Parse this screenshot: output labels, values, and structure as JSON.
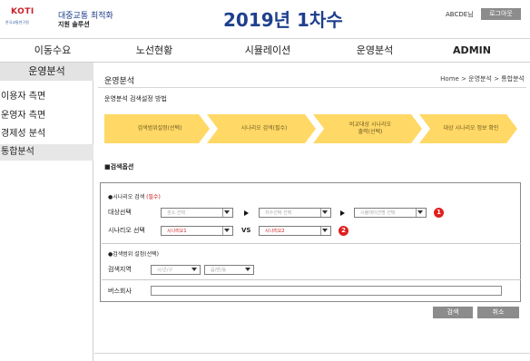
{
  "header": {
    "logo_text": "KOTI",
    "logo_sub": "한국교통연구원",
    "logo_title": "대중교통 최적화",
    "logo_subtitle": "지원 솔루션",
    "page_title": "2019년 1차수",
    "user_name": "ABCDE님",
    "logout_label": "로그아웃"
  },
  "topnav": {
    "items": [
      "이동수요",
      "노선현황",
      "시뮬레이션",
      "운영분석",
      "ADMIN"
    ]
  },
  "sidebar": {
    "title": "운영분석",
    "items": [
      "이용자 측면",
      "운영자 측면",
      "경제성 분석",
      "통합분석"
    ]
  },
  "main": {
    "title": "운영분석",
    "breadcrumb": "Home > 운영분석 > 통합분석",
    "subtitle": "운영분석 검색설정 방법",
    "steps": [
      "검색범위설정(선택)",
      "시나리오 검색(필수)",
      "비교대상 시나리오\n출력(선택)",
      "대상 시나리오 정보 확인"
    ],
    "search_options_label": "■검색옵션",
    "scenario_section": {
      "label": "●시나리오 검색 ",
      "required": "(필수)"
    },
    "target_select_label": "대상선택",
    "target_selects": [
      "권소 선택",
      "차수선택 선택",
      "시뮬레이션명 선택"
    ],
    "scenario_select_label": "시나리오 선택",
    "scenario_a": "시나리오1",
    "vs_label": "VS",
    "scenario_b": "시나리오2",
    "badge_1": "1",
    "badge_2": "2",
    "range_section_label": "●검색범위 설정(선택)",
    "region_label": "검색지역",
    "region_selects": [
      "시/군/구",
      "읍/면/동"
    ],
    "bus_company_label": "버스회사",
    "bus_company_value": "",
    "search_button": "검색",
    "cancel_button": "취소"
  },
  "colors": {
    "accent": "#1e3f8c",
    "step_fill": "#ffd866",
    "badge": "#e01f1f",
    "button": "#8c8c8c"
  }
}
